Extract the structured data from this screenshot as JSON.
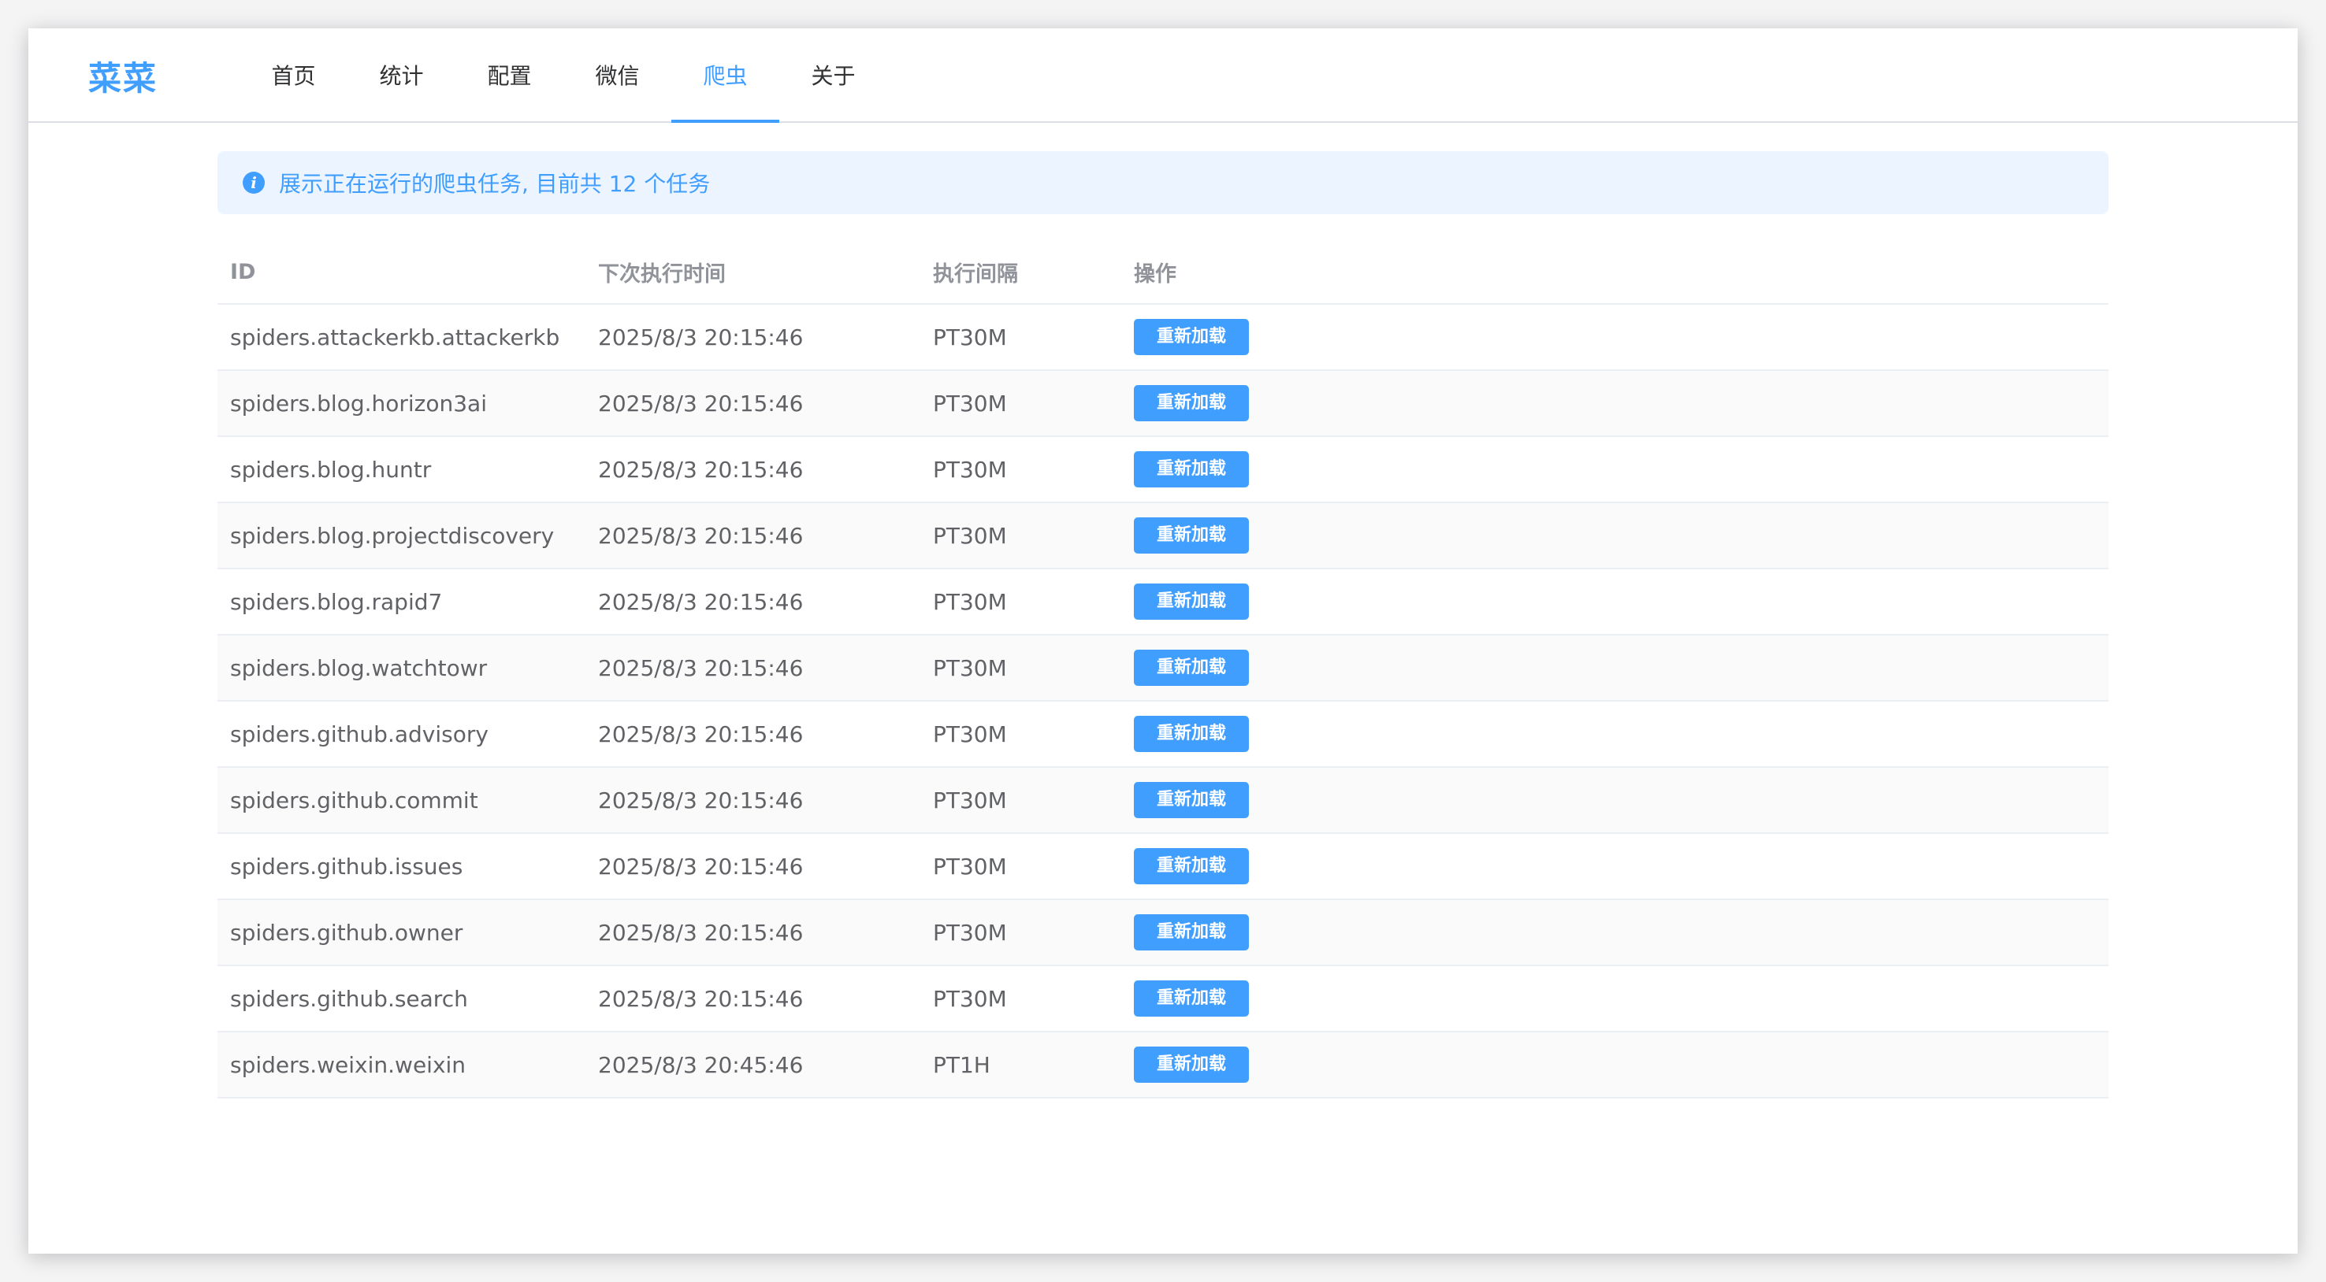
{
  "app": {
    "logo": "菜菜",
    "accent_color": "#409eff"
  },
  "nav": {
    "items": [
      {
        "label": "首页",
        "active": false
      },
      {
        "label": "统计",
        "active": false
      },
      {
        "label": "配置",
        "active": false
      },
      {
        "label": "微信",
        "active": false
      },
      {
        "label": "爬虫",
        "active": true
      },
      {
        "label": "关于",
        "active": false
      }
    ]
  },
  "alert": {
    "icon": "info-icon",
    "text": "展示正在运行的爬虫任务, 目前共 12 个任务"
  },
  "table": {
    "headers": [
      "ID",
      "下次执行时间",
      "执行间隔",
      "操作"
    ],
    "action_label": "重新加载",
    "rows": [
      {
        "id": "spiders.attackerkb.attackerkb",
        "next_run": "2025/8/3 20:15:46",
        "interval": "PT30M"
      },
      {
        "id": "spiders.blog.horizon3ai",
        "next_run": "2025/8/3 20:15:46",
        "interval": "PT30M"
      },
      {
        "id": "spiders.blog.huntr",
        "next_run": "2025/8/3 20:15:46",
        "interval": "PT30M"
      },
      {
        "id": "spiders.blog.projectdiscovery",
        "next_run": "2025/8/3 20:15:46",
        "interval": "PT30M"
      },
      {
        "id": "spiders.blog.rapid7",
        "next_run": "2025/8/3 20:15:46",
        "interval": "PT30M"
      },
      {
        "id": "spiders.blog.watchtowr",
        "next_run": "2025/8/3 20:15:46",
        "interval": "PT30M"
      },
      {
        "id": "spiders.github.advisory",
        "next_run": "2025/8/3 20:15:46",
        "interval": "PT30M"
      },
      {
        "id": "spiders.github.commit",
        "next_run": "2025/8/3 20:15:46",
        "interval": "PT30M"
      },
      {
        "id": "spiders.github.issues",
        "next_run": "2025/8/3 20:15:46",
        "interval": "PT30M"
      },
      {
        "id": "spiders.github.owner",
        "next_run": "2025/8/3 20:15:46",
        "interval": "PT30M"
      },
      {
        "id": "spiders.github.search",
        "next_run": "2025/8/3 20:15:46",
        "interval": "PT30M"
      },
      {
        "id": "spiders.weixin.weixin",
        "next_run": "2025/8/3 20:45:46",
        "interval": "PT1H"
      }
    ]
  }
}
